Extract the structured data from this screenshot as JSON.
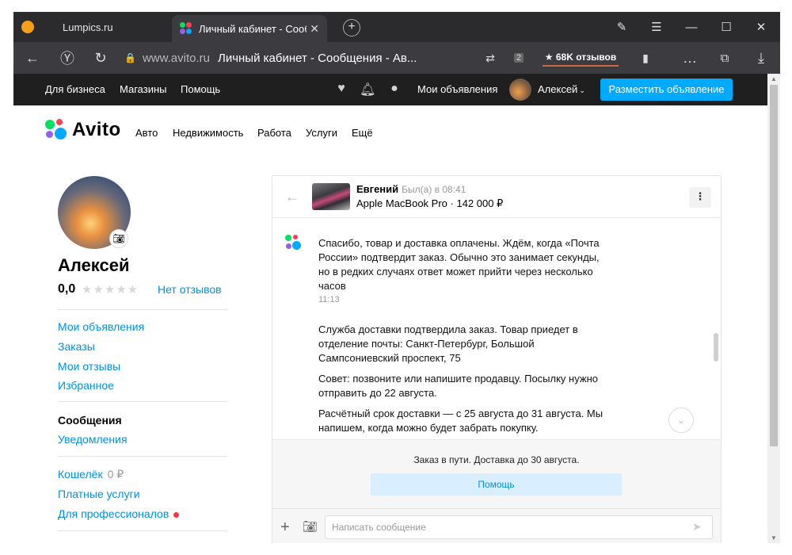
{
  "browser": {
    "tabs": [
      {
        "title": "Lumpics.ru"
      },
      {
        "title": "Личный кабинет - Сооб",
        "close": "✕"
      }
    ],
    "new_tab": "+",
    "url_host": "www.avito.ru",
    "url_title": "Личный кабинет - Сообщения - Ав...",
    "reviews_chip": "★ 68K отзывов",
    "extension_badge": "2"
  },
  "topbar": {
    "for_business": "Для бизнеса",
    "shops": "Магазины",
    "help": "Помощь",
    "my_ads": "Мои объявления",
    "user": "Алексей",
    "post_ad": "Разместить объявление"
  },
  "sitenav": {
    "logo": "Avito",
    "links": [
      "Авто",
      "Недвижимость",
      "Работа",
      "Услуги",
      "Ещё"
    ]
  },
  "profile": {
    "name": "Алексей",
    "rating": "0,0",
    "stars": "★★★★★",
    "no_reviews": "Нет отзывов",
    "menu_group1": [
      "Мои объявления",
      "Заказы",
      "Мои отзывы",
      "Избранное"
    ],
    "active": "Сообщения",
    "notifications": "Уведомления",
    "wallet": "Кошелёк",
    "wallet_amount": "0 ₽",
    "paid_services": "Платные услуги",
    "for_pros": "Для профессионалов"
  },
  "chat": {
    "seller": "Евгений",
    "seller_status": "Был(а) в 08:41",
    "product": "Apple MacBook Pro · 142 000 ₽",
    "messages": [
      "Спасибо, товар и доставка оплачены. Ждём, когда «Почта России» подтвердит заказ. Обычно это занимает секунды, но в редких случаях ответ может прийти через несколько часов",
      "Служба доставки подтвердила заказ. Товар приедет в отделение почты: Санкт-Петербург, Большой Сампсониевский проспект, 75",
      "Совет: позвоните или напишите продавцу. Посылку нужно отправить до 22 августа.",
      "Расчётный срок доставки — с 25 августа до 31 августа. Мы напишем, когда можно будет забрать покупку."
    ],
    "time": "11:13",
    "status": "Заказ в пути. Доставка до 30 августа.",
    "help_button": "Помощь",
    "input_placeholder": "Написать сообщение"
  },
  "colors": {
    "accent": "#00aaff",
    "link": "#0091d9",
    "topbar_bg": "#1f1f1f"
  }
}
